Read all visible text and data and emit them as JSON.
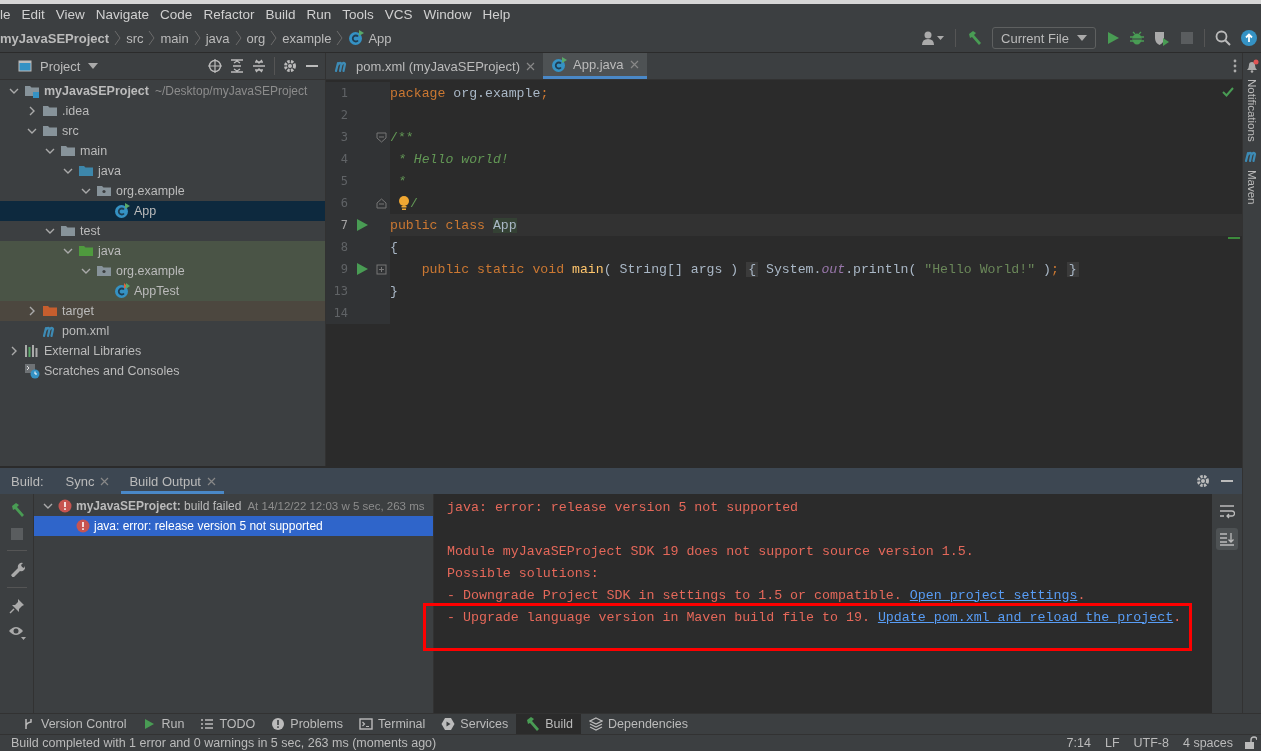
{
  "menu_bar": [
    "le",
    "Edit",
    "View",
    "Navigate",
    "Code",
    "Refactor",
    "Build",
    "Run",
    "Tools",
    "VCS",
    "Window",
    "Help"
  ],
  "breadcrumbs": [
    {
      "label": "myJavaSEProject",
      "kind": "project"
    },
    {
      "label": "src",
      "kind": "dir"
    },
    {
      "label": "main",
      "kind": "dir"
    },
    {
      "label": "java",
      "kind": "dir"
    },
    {
      "label": "org",
      "kind": "dir"
    },
    {
      "label": "example",
      "kind": "dir"
    },
    {
      "label": "App",
      "kind": "class"
    }
  ],
  "toolbar": {
    "run_config": "Current File"
  },
  "project_panel": {
    "title": "Project",
    "tree": [
      {
        "label": "myJavaSEProject",
        "hint": "~/Desktop/myJavaSEProject",
        "kind": "project",
        "expanded": true,
        "selected": false,
        "children": [
          {
            "label": ".idea",
            "kind": "folder",
            "expanded": false,
            "selected": false
          },
          {
            "label": "src",
            "kind": "folder",
            "expanded": true,
            "selected": false,
            "children": [
              {
                "label": "main",
                "kind": "folder",
                "expanded": true,
                "selected": false,
                "children": [
                  {
                    "label": "java",
                    "kind": "source-folder",
                    "expanded": true,
                    "selected": false,
                    "children": [
                      {
                        "label": "org.example",
                        "kind": "package",
                        "expanded": true,
                        "selected": false,
                        "children": [
                          {
                            "label": "App",
                            "kind": "class-runnable",
                            "selected": true
                          }
                        ]
                      }
                    ]
                  }
                ]
              },
              {
                "label": "test",
                "kind": "folder",
                "expanded": true,
                "selected": false,
                "children": [
                  {
                    "label": "java",
                    "kind": "test-folder",
                    "expanded": true,
                    "selected": false,
                    "color": "#4a5446",
                    "children": [
                      {
                        "label": "org.example",
                        "kind": "package",
                        "expanded": true,
                        "selected": false,
                        "color": "#4a5446",
                        "children": [
                          {
                            "label": "AppTest",
                            "kind": "test-class",
                            "selected": false,
                            "color": "#4a5446"
                          }
                        ]
                      }
                    ]
                  }
                ]
              }
            ]
          },
          {
            "label": "target",
            "kind": "excluded-folder",
            "expanded": false,
            "selected": false,
            "color": "#4c473f"
          },
          {
            "label": "pom.xml",
            "kind": "maven",
            "selected": false
          }
        ]
      },
      {
        "label": "External Libraries",
        "kind": "libraries",
        "expanded": false,
        "selected": false
      },
      {
        "label": "Scratches and Consoles",
        "kind": "scratches",
        "selected": false
      }
    ]
  },
  "editor_tabs": [
    {
      "label": "pom.xml (myJavaSEProject)",
      "kind": "maven",
      "selected": false
    },
    {
      "label": "App.java",
      "kind": "class",
      "selected": true
    }
  ],
  "editor": {
    "lines": [
      {
        "number": "1",
        "current": false,
        "tokens": [
          {
            "text": "package ",
            "kind": "keyword"
          },
          {
            "text": "org.example",
            "kind": "plain"
          },
          {
            "text": ";",
            "kind": "keyword"
          }
        ]
      },
      {
        "number": "2",
        "current": false
      },
      {
        "number": "3",
        "current": false,
        "markers": [
          {
            "kind": "fold-start"
          }
        ],
        "tokens": [
          {
            "text": "/**",
            "kind": "doc"
          }
        ]
      },
      {
        "number": "4",
        "current": false,
        "tokens": [
          {
            "text": " * Hello world!",
            "kind": "doc-italic"
          }
        ]
      },
      {
        "number": "5",
        "current": false,
        "tokens": [
          {
            "text": " *",
            "kind": "doc-italic"
          }
        ]
      },
      {
        "number": "6",
        "current": false,
        "markers": [
          {
            "kind": "fold-end"
          }
        ],
        "tokens": [
          {
            "kind": "bulb"
          },
          {
            "text": "/",
            "kind": "doc"
          }
        ]
      },
      {
        "number": "7",
        "current": true,
        "markers": [
          {
            "kind": "run"
          }
        ],
        "tokens": [
          {
            "text": "public class ",
            "kind": "keyword"
          },
          {
            "text": "App",
            "kind": "declaration"
          }
        ]
      },
      {
        "number": "8",
        "current": false,
        "tokens": [
          {
            "text": "{",
            "kind": "plain"
          }
        ]
      },
      {
        "number": "9",
        "current": false,
        "markers": [
          {
            "kind": "run"
          },
          {
            "kind": "fold-collapsed"
          }
        ],
        "tokens": [
          {
            "text": "    public static void ",
            "kind": "keyword"
          },
          {
            "text": "main",
            "kind": "method"
          },
          {
            "text": "( String[] args ) ",
            "kind": "plain"
          },
          {
            "text": "{",
            "kind": "folded"
          },
          {
            "text": " System.",
            "kind": "plain"
          },
          {
            "text": "out",
            "kind": "static"
          },
          {
            "text": ".println( ",
            "kind": "plain"
          },
          {
            "text": "\"Hello World!\"",
            "kind": "string"
          },
          {
            "text": " )",
            "kind": "plain"
          },
          {
            "text": "; ",
            "kind": "keyword"
          },
          {
            "text": "}",
            "kind": "folded"
          }
        ]
      },
      {
        "number": "13",
        "current": false,
        "tokens": [
          {
            "text": "}",
            "kind": "plain"
          }
        ]
      },
      {
        "number": "14",
        "current": false
      }
    ]
  },
  "right_strip": [
    "Notifications",
    "Maven"
  ],
  "build_panel": {
    "label": "Build:",
    "tabs": [
      {
        "label": "Sync",
        "selected": false
      },
      {
        "label": "Build Output",
        "selected": true
      }
    ],
    "tree": [
      {
        "title": "**myJavaSEProject:** build failed",
        "detail": "At 14/12/22 12:03 w 5 sec, 263 ms",
        "kind": "error",
        "expanded": true,
        "selected": false,
        "children": [
          {
            "title": "java: error: release version 5 not supported",
            "kind": "error",
            "selected": true
          }
        ]
      }
    ],
    "console": [
      {
        "kind": "text",
        "segments": [
          {
            "text": "java: error: release version 5 not supported",
            "kind": "error"
          }
        ]
      },
      {
        "kind": "blank"
      },
      {
        "kind": "text",
        "segments": [
          {
            "text": "Module myJavaSEProject SDK 19 does not support source version 1.5.",
            "kind": "error"
          }
        ]
      },
      {
        "kind": "text",
        "segments": [
          {
            "text": "Possible solutions:",
            "kind": "error"
          }
        ]
      },
      {
        "kind": "text",
        "segments": [
          {
            "text": "- Downgrade Project SDK in settings to 1.5 or compatible. ",
            "kind": "error"
          },
          {
            "text": "Open project settings",
            "kind": "link"
          },
          {
            "text": ".",
            "kind": "error"
          }
        ]
      },
      {
        "kind": "framed",
        "segments": [
          {
            "text": "- Upgrade language version in Maven build file to 19. ",
            "kind": "error"
          },
          {
            "text": "Update pom.xml and reload the project",
            "kind": "link"
          },
          {
            "text": ".",
            "kind": "error"
          }
        ]
      }
    ]
  },
  "tool_windows": [
    {
      "label": "Version Control",
      "kind": "branch",
      "selected": false
    },
    {
      "label": "Run",
      "kind": "run",
      "selected": false
    },
    {
      "label": "TODO",
      "kind": "list",
      "selected": false
    },
    {
      "label": "Problems",
      "kind": "problems",
      "selected": false
    },
    {
      "label": "Terminal",
      "kind": "terminal",
      "selected": false
    },
    {
      "label": "Services",
      "kind": "services",
      "selected": false
    },
    {
      "label": "Build",
      "kind": "hammer",
      "selected": true
    },
    {
      "label": "Dependencies",
      "kind": "layers",
      "selected": false
    }
  ],
  "status_bar": {
    "message": "Build completed with 1 error and 0 warnings in 5 sec, 263 ms (moments ago)",
    "items": [
      "7:14",
      "LF",
      "UTF-8",
      "4 spaces"
    ]
  }
}
